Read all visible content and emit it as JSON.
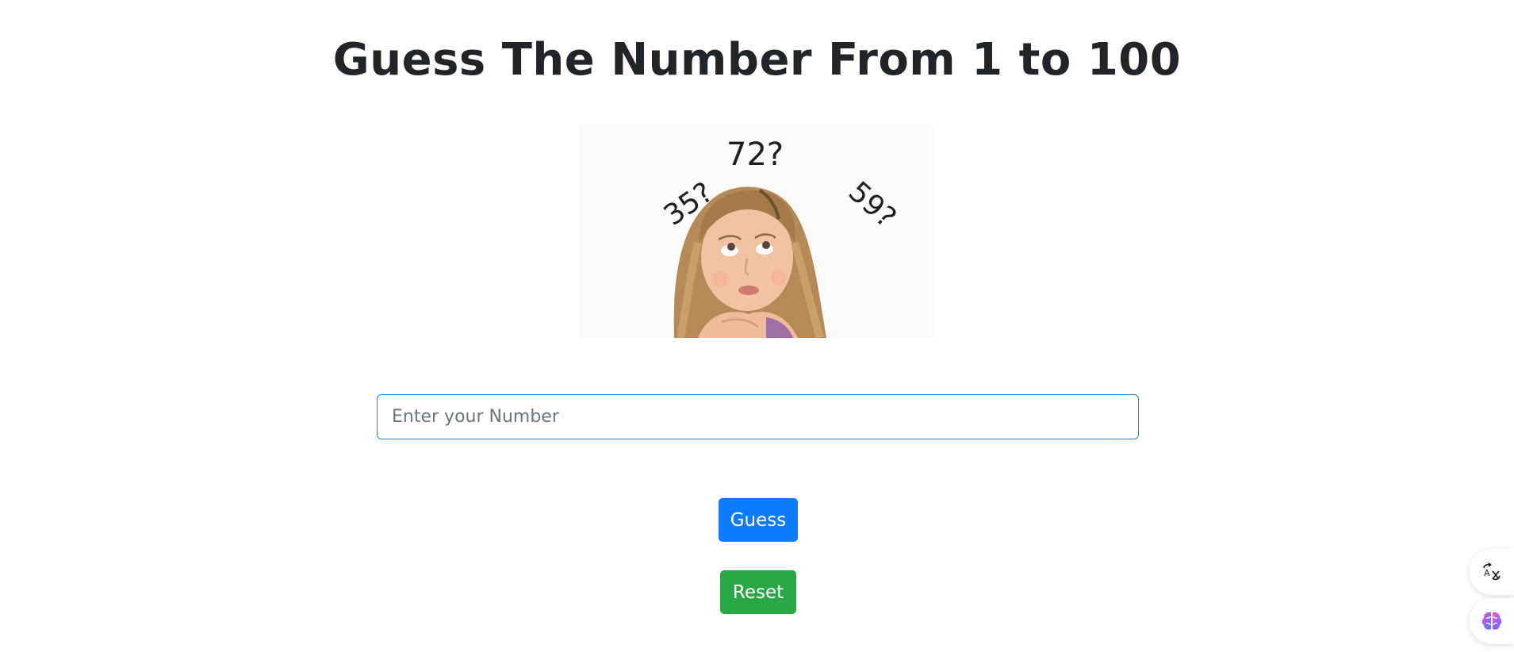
{
  "header": {
    "title": "Guess The Number From 1 to 100"
  },
  "hero": {
    "guesses": [
      "72?",
      "35?",
      "59?"
    ]
  },
  "form": {
    "number_placeholder": "Enter your Number",
    "number_value": ""
  },
  "actions": {
    "guess_label": "Guess",
    "reset_label": "Reset"
  },
  "colors": {
    "guess_button": "#0d7bfd",
    "reset_button": "#28a745",
    "input_focus_border": "#1a8ad6"
  },
  "side_tools": {
    "icons": [
      "translate-icon",
      "brain-icon"
    ]
  }
}
